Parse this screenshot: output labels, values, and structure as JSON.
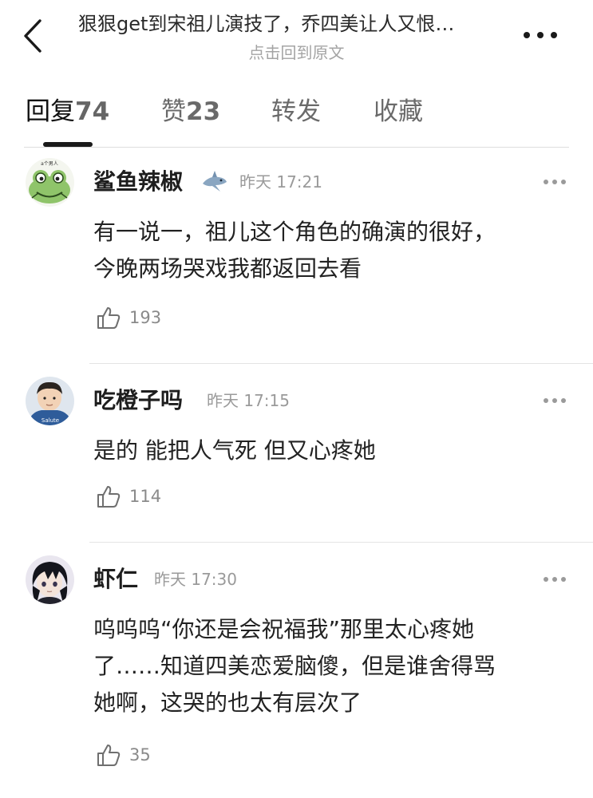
{
  "header": {
    "title": "狠狠get到宋祖儿演技了，乔四美让人又恨…",
    "subtitle": "点击回到原文",
    "back_icon": "chevron-left-icon",
    "more_icon": "more-dots-icon"
  },
  "tabs": [
    {
      "label": "回复",
      "count": "74",
      "active": true
    },
    {
      "label": "赞",
      "count": "23",
      "active": false
    },
    {
      "label": "转发",
      "count": "",
      "active": false
    },
    {
      "label": "收藏",
      "count": "",
      "active": false
    }
  ],
  "comments": [
    {
      "user": "鲨鱼辣椒",
      "badge_icon": "shark-emoji-icon",
      "time": "昨天 17:21",
      "lines": [
        "有一说一，祖儿这个角色的确演的很好，",
        "今晚两场哭戏我都返回去看"
      ],
      "likes": "193",
      "avatar_icon": "frog-avatar-icon",
      "avatar_text": "a个男人"
    },
    {
      "user": "吃橙子吗",
      "time": "昨天 17:15",
      "lines": [
        "是的 能把人气死 但又心疼她"
      ],
      "likes": "114",
      "avatar_icon": "boy-salute-avatar-icon",
      "avatar_text": "Salute"
    },
    {
      "user": "虾仁",
      "time": "昨天 17:30",
      "lines": [
        "呜呜呜“你还是会祝福我”那里太心疼她",
        "了……知道四美恋爱脑傻，但是谁舍得骂",
        "她啊，这哭的也太有层次了"
      ],
      "likes": "35",
      "avatar_icon": "anime-boy-avatar-icon"
    }
  ],
  "colors": {
    "text_primary": "#222222",
    "text_secondary": "#9a9a9a",
    "divider": "#e4e4e4",
    "tab_underline": "#1a1a1a"
  }
}
